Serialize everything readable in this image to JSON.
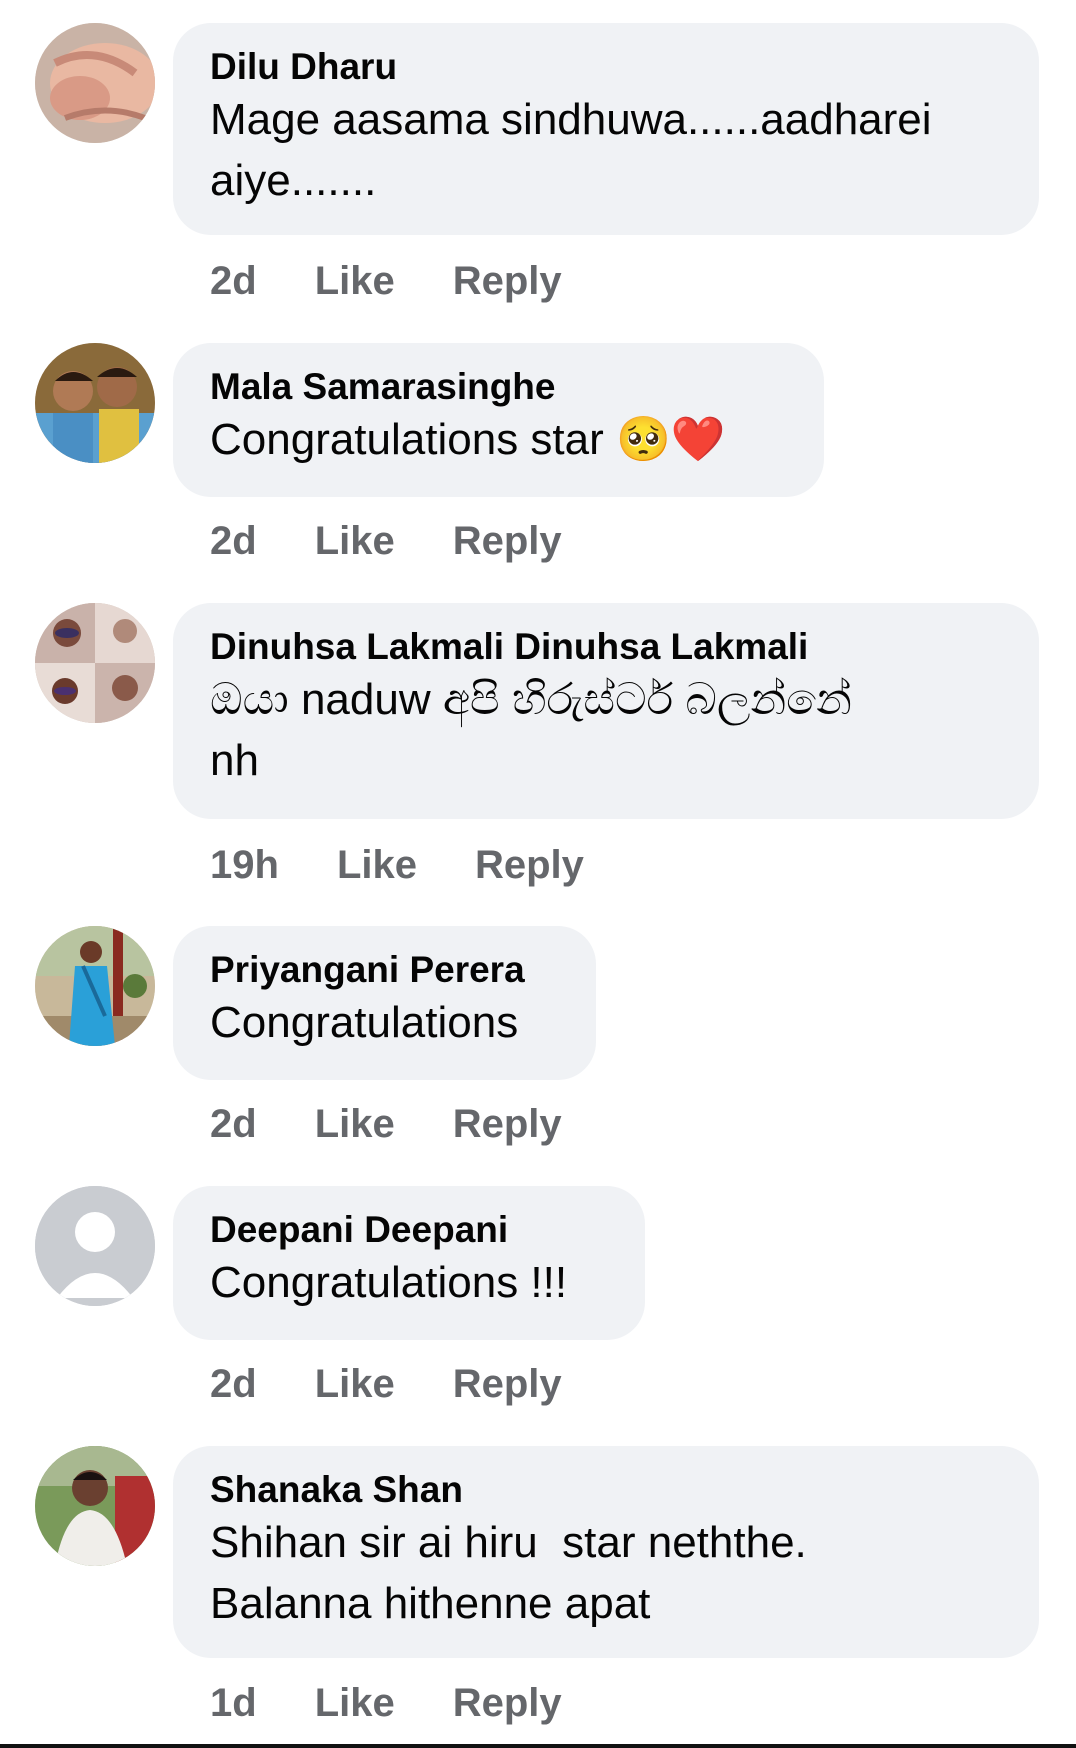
{
  "comments": [
    {
      "author": "Dilu Dharu",
      "lines": [
        "Mage aasama sindhuwa......aadharei",
        "aiye......."
      ],
      "time": "2d",
      "like_label": "Like",
      "reply_label": "Reply",
      "avatar_icon": "avatar-photo-hands"
    },
    {
      "author": "Mala Samarasinghe",
      "lines": [
        "Congratulations star 🥺❤️"
      ],
      "time": "2d",
      "like_label": "Like",
      "reply_label": "Reply",
      "avatar_icon": "avatar-photo-two-people"
    },
    {
      "author": "Dinuhsa Lakmali Dinuhsa Lakmali",
      "lines": [
        "ඔයා naduw අපි හිරුස්ටර් බලන්නේ",
        "nh"
      ],
      "time": "19h",
      "like_label": "Like",
      "reply_label": "Reply",
      "avatar_icon": "avatar-photo-collage"
    },
    {
      "author": "Priyangani Perera",
      "lines": [
        "Congratulations"
      ],
      "time": "2d",
      "like_label": "Like",
      "reply_label": "Reply",
      "avatar_icon": "avatar-photo-woman-saree"
    },
    {
      "author": "Deepani Deepani",
      "lines": [
        "Congratulations !!!"
      ],
      "time": "2d",
      "like_label": "Like",
      "reply_label": "Reply",
      "avatar_icon": "default-avatar-icon"
    },
    {
      "author": "Shanaka Shan",
      "lines": [
        "Shihan sir ai hiru  star neththe.",
        "Balanna hithenne apat"
      ],
      "time": "1d",
      "like_label": "Like",
      "reply_label": "Reply",
      "avatar_icon": "avatar-photo-man"
    }
  ],
  "colors": {
    "bubble_bg": "#f0f2f5",
    "meta_text": "#65676b",
    "primary_text": "#050505"
  }
}
